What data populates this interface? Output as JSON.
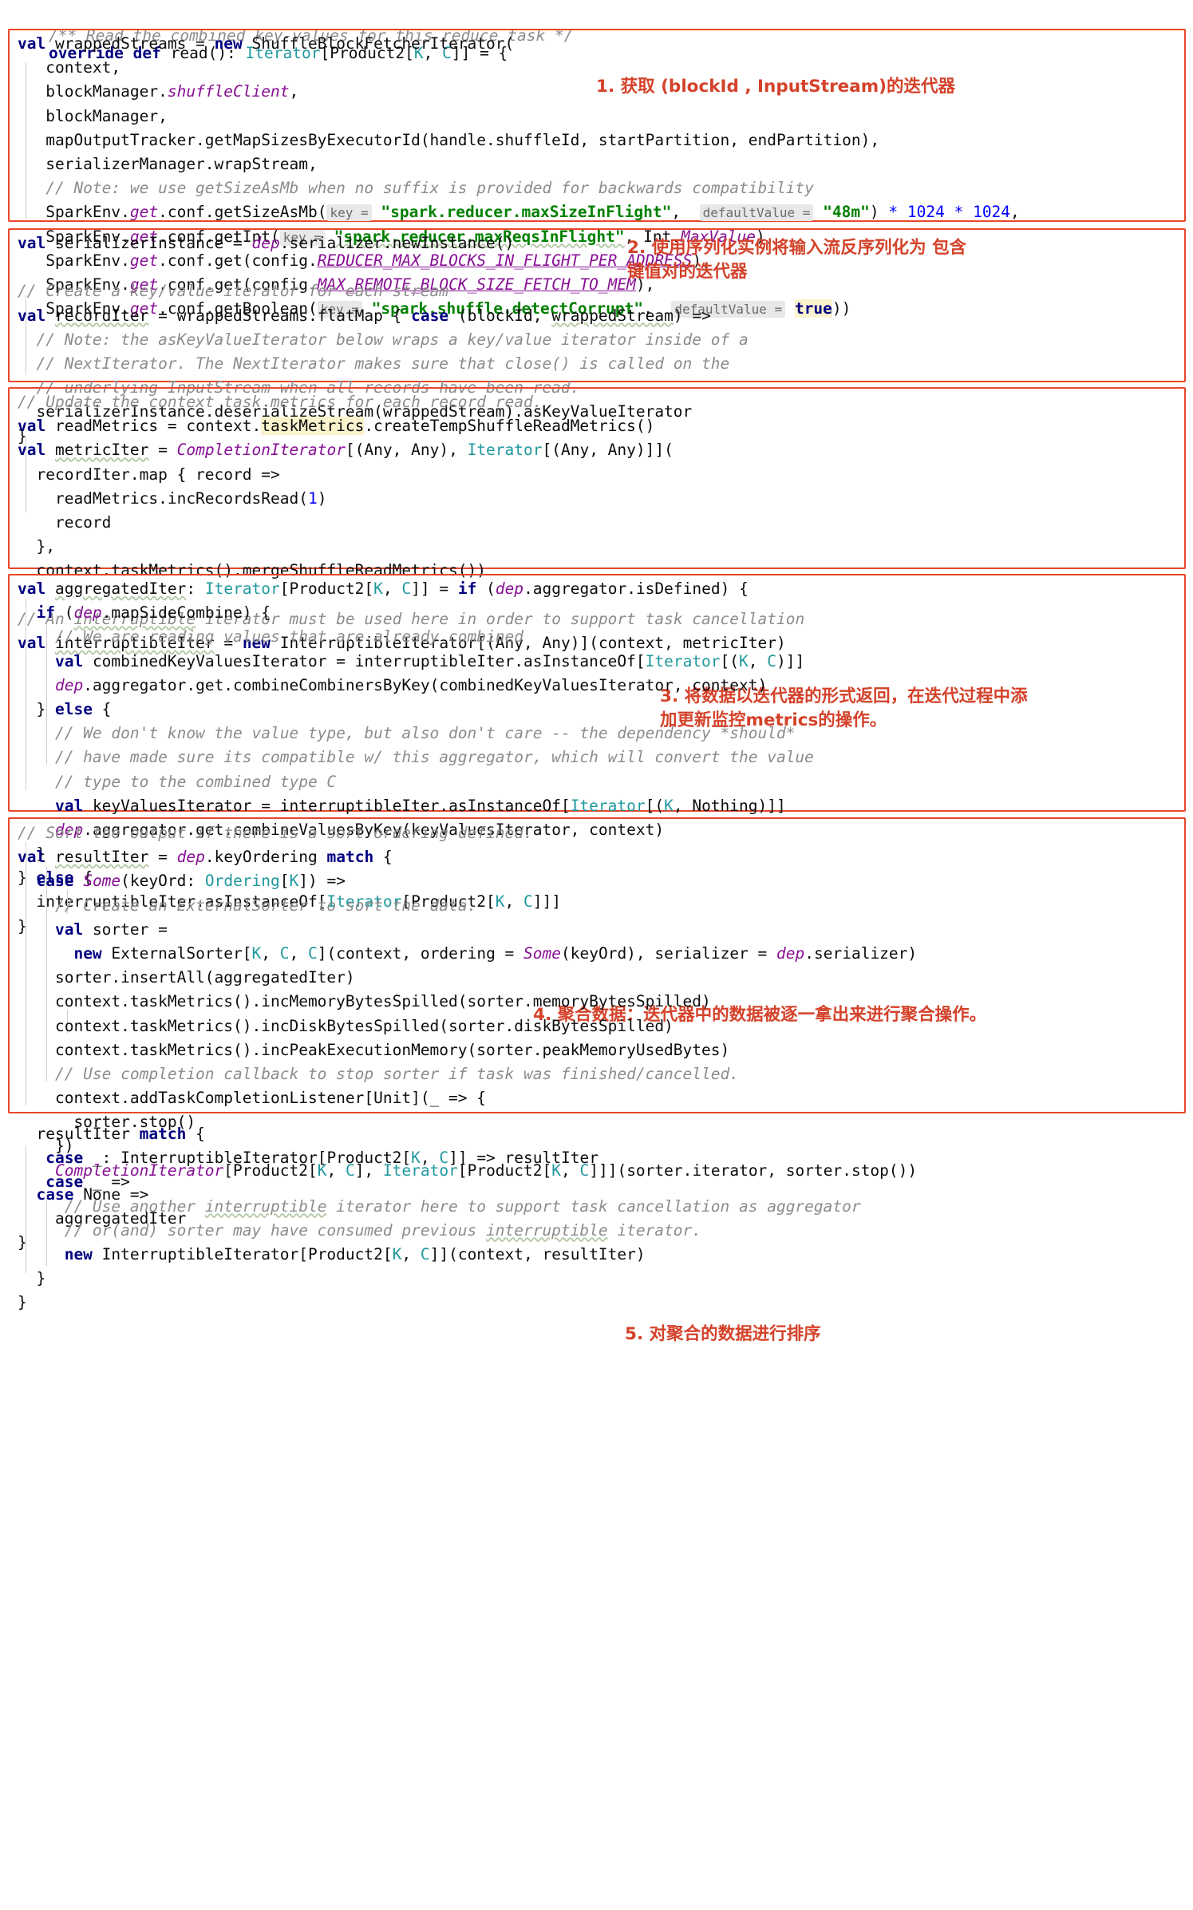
{
  "meta": {
    "app": "code-editor",
    "language": "Scala",
    "file_subject": "BlockStoreShuffleReader.read",
    "colors": {
      "annotation_red": "#d4422a",
      "box_red": "#e8472a",
      "keyword_navy": "#000080",
      "class_teal": "#20999d",
      "string_green": "#008000",
      "number_blue": "#0000ff",
      "comment_gray": "#8c8c8c",
      "field_purple": "#871094",
      "hint_bg": "#e8e8e8",
      "highlight_yellow": "#fbf3ce"
    }
  },
  "header": {
    "doc_comment": "/** Read the combined key-values for this reduce task */",
    "signature_parts": {
      "override": "override",
      "def": "def",
      "name": " read(): ",
      "iterator": "Iterator",
      "rest": "[Product2[",
      "k": "K",
      "comma": ", ",
      "c": "C",
      "tail": "]] = {"
    }
  },
  "annotations": [
    {
      "id": 1,
      "text": "1. 获取 (blockId , InputStream)的迭代器"
    },
    {
      "id": 2,
      "line1": "2. 使用序列化实例将输入流反序列化为 包含",
      "line2": "键值对的迭代器"
    },
    {
      "id": 3,
      "line1": "3. 将数据以迭代器的形式返回，在迭代过程中添",
      "line2": "加更新监控metrics的操作。"
    },
    {
      "id": 4,
      "text": "4. 聚合数据：迭代器中的数据被逐一拿出来进行聚合操作。"
    },
    {
      "id": 5,
      "text": "5. 对聚合的数据进行排序"
    }
  ],
  "blocks": {
    "block1": {
      "lines": [
        "val wrappedStreams = new ShuffleBlockFetcherIterator(",
        "  context,",
        "  blockManager.shuffleClient,",
        "  blockManager,",
        "  mapOutputTracker.getMapSizesByExecutorId(handle.shuffleId, startPartition, endPartition),",
        "  serializerManager.wrapStream,",
        "  // Note: we use getSizeAsMb when no suffix is provided for backwards compatibility",
        "  SparkEnv.get.conf.getSizeAsMb( key = \"spark.reducer.maxSizeInFlight\",  defaultValue = \"48m\") * 1024 * 1024,",
        "  SparkEnv.get.conf.getInt( key = \"spark.reducer.maxReqsInFlight\", Int.MaxValue),",
        "  SparkEnv.get.conf.get(config.REDUCER_MAX_BLOCKS_IN_FLIGHT_PER_ADDRESS),",
        "  SparkEnv.get.conf.get(config.MAX_REMOTE_BLOCK_SIZE_FETCH_TO_MEM),",
        "  SparkEnv.get.conf.getBoolean( key = \"spark.shuffle.detectCorrupt\",  defaultValue = true))"
      ],
      "hint_key": "key =",
      "hint_default": "defaultValue =",
      "strings": [
        "\"spark.reducer.maxSizeInFlight\"",
        "\"48m\"",
        "\"spark.reducer.maxReqsInFlight\"",
        "\"spark.shuffle.detectCorrupt\""
      ],
      "numbers": [
        "1024",
        "1024"
      ],
      "bool_default": "true"
    },
    "block2": {
      "lines": [
        "val serializerInstance = dep.serializer.newInstance()",
        "",
        "// Create a key/value iterator for each stream",
        "val recordIter = wrappedStreams.flatMap { case (blockId, wrappedStream) =>",
        "  // Note: the asKeyValueIterator below wraps a key/value iterator inside of a",
        "  // NextIterator. The NextIterator makes sure that close() is called on the",
        "  // underlying InputStream when all records have been read.",
        "  serializerInstance.deserializeStream(wrappedStream).asKeyValueIterator",
        "}"
      ]
    },
    "block3": {
      "lines": [
        "// Update the context task metrics for each record read.",
        "val readMetrics = context.taskMetrics.createTempShuffleReadMetrics()",
        "val metricIter = CompletionIterator[(Any, Any), Iterator[(Any, Any)]](",
        "  recordIter.map { record =>",
        "    readMetrics.incRecordsRead(1)",
        "    record",
        "  },",
        "  context.taskMetrics().mergeShuffleReadMetrics())",
        "",
        "// An interruptible iterator must be used here in order to support task cancellation",
        "val interruptibleIter = new InterruptibleIterator[(Any, Any)](context, metricIter)"
      ],
      "highlighted_token": "taskMetrics"
    },
    "block4": {
      "lines": [
        "val aggregatedIter: Iterator[Product2[K, C]] = if (dep.aggregator.isDefined) {",
        "  if (dep.mapSideCombine) {",
        "    // We are reading values that are already combined",
        "    val combinedKeyValuesIterator = interruptibleIter.asInstanceOf[Iterator[(K, C)]]",
        "    dep.aggregator.get.combineCombinersByKey(combinedKeyValuesIterator, context)",
        "  } else {",
        "    // We don't know the value type, but also don't care -- the dependency *should*",
        "    // have made sure its compatible w/ this aggregator, which will convert the value",
        "    // type to the combined type C",
        "    val keyValuesIterator = interruptibleIter.asInstanceOf[Iterator[(K, Nothing)]]",
        "    dep.aggregator.get.combineValuesByKey(keyValuesIterator, context)",
        "  }",
        "} else {",
        "  interruptibleIter.asInstanceOf[Iterator[Product2[K, C]]]",
        "}"
      ]
    },
    "block5": {
      "lines": [
        "// Sort the output if there is a sort ordering defined.",
        "val resultIter = dep.keyOrdering match {",
        "  case Some(keyOrd: Ordering[K]) =>",
        "    // Create an ExternalSorter to sort the data.",
        "    val sorter =",
        "      new ExternalSorter[K, C, C](context, ordering = Some(keyOrd), serializer = dep.serializer)",
        "    sorter.insertAll(aggregatedIter)",
        "    context.taskMetrics().incMemoryBytesSpilled(sorter.memoryBytesSpilled)",
        "    context.taskMetrics().incDiskBytesSpilled(sorter.diskBytesSpilled)",
        "    context.taskMetrics().incPeakExecutionMemory(sorter.peakMemoryUsedBytes)",
        "    // Use completion callback to stop sorter if task was finished/cancelled.",
        "    context.addTaskCompletionListener[Unit](_ => {",
        "      sorter.stop()",
        "    })",
        "    CompletionIterator[Product2[K, C], Iterator[Product2[K, C]]](sorter.iterator, sorter.stop())",
        "  case None =>",
        "    aggregatedIter",
        "}"
      ]
    },
    "footer": {
      "lines": [
        "resultIter match {",
        "  case _: InterruptibleIterator[Product2[K, C]] => resultIter",
        "  case _ =>",
        "    // Use another interruptible iterator here to support task cancellation as aggregator",
        "    // or(and) sorter may have consumed previous interruptible iterator.",
        "    new InterruptibleIterator[Product2[K, C]](context, resultIter)",
        "}",
        "}"
      ]
    }
  }
}
